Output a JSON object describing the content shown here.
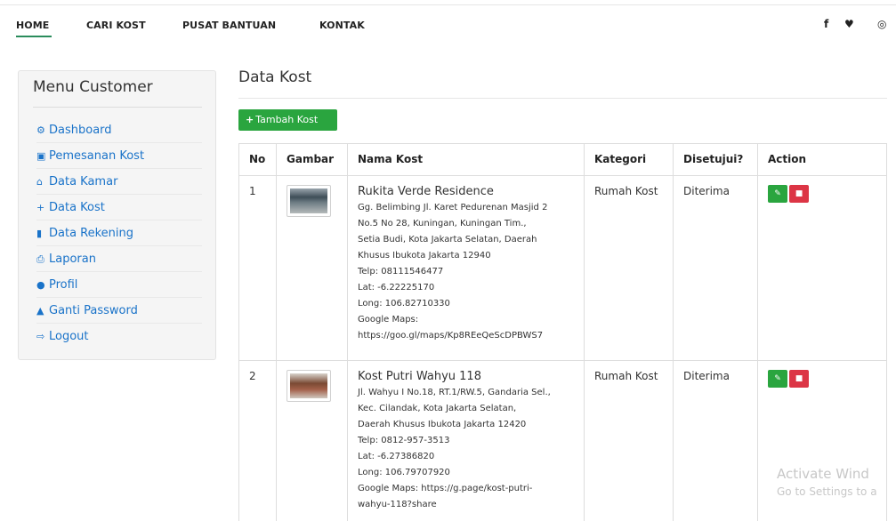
{
  "nav": {
    "items": [
      "HOME",
      "CARI KOST",
      "PUSAT BANTUAN",
      "KONTAK"
    ],
    "social": [
      "f",
      "♥",
      "◎"
    ]
  },
  "sidebar": {
    "title": "Menu Customer",
    "items": [
      {
        "icon": "⚙",
        "label": "Dashboard"
      },
      {
        "icon": "▣",
        "label": "Pemesanan Kost"
      },
      {
        "icon": "⌂",
        "label": "Data Kamar"
      },
      {
        "icon": "+",
        "label": "Data Kost"
      },
      {
        "icon": "▮",
        "label": "Data Rekening"
      },
      {
        "icon": "⎙",
        "label": "Laporan"
      },
      {
        "icon": "●",
        "label": "Profil"
      },
      {
        "icon": "▲",
        "label": "Ganti Password"
      },
      {
        "icon": "⇨",
        "label": "Logout"
      }
    ]
  },
  "main": {
    "title": "Data Kost",
    "add_button": "Tambah Kost",
    "table": {
      "headers": [
        "No",
        "Gambar",
        "Nama Kost",
        "Kategori",
        "Disetujui?",
        "Action"
      ],
      "rows": [
        {
          "no": "1",
          "name": "Rukita Verde Residence",
          "details": [
            "Gg. Belimbing Jl. Karet Pedurenan Masjid 2",
            "No.5 No 28, Kuningan, Kuningan Tim.,",
            "Setia Budi, Kota Jakarta Selatan, Daerah",
            "Khusus Ibukota Jakarta 12940",
            "Telp: 08111546477",
            "Lat: -6.22225170",
            "Long: 106.82710330",
            "Google Maps:",
            "https://goo.gl/maps/Kp8REeQeScDPBWS7"
          ],
          "kategori": "Rumah Kost",
          "status": "Diterima"
        },
        {
          "no": "2",
          "name": "Kost Putri Wahyu 118",
          "details": [
            "Jl. Wahyu I No.18, RT.1/RW.5, Gandaria Sel.,",
            "Kec. Cilandak, Kota Jakarta Selatan,",
            "Daerah Khusus Ibukota Jakarta 12420",
            "Telp: 0812-957-3513",
            "Lat: -6.27386820",
            "Long: 106.79707920",
            "Google Maps: https://g.page/kost-putri-",
            "wahyu-118?share"
          ],
          "kategori": "Rumah Kost",
          "status": "Diterima"
        }
      ]
    }
  },
  "actions": {
    "edit_icon": "✎",
    "delete_icon": "■"
  },
  "watermark": {
    "line1": "Activate Wind",
    "line2": "Go to Settings to a"
  },
  "colors": {
    "link": "#1a73c9",
    "success": "#2aa53f",
    "danger": "#dc3545",
    "accent_underline": "#2a8c5c"
  }
}
